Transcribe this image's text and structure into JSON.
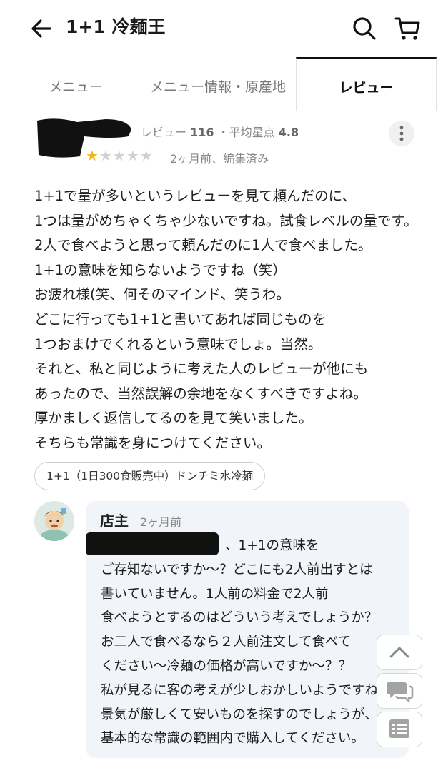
{
  "header": {
    "title": "1+1 冷麺王",
    "back_icon": "arrow-left-icon",
    "search_icon": "search-icon",
    "cart_icon": "cart-icon"
  },
  "tabs": [
    {
      "label": "メニュー",
      "active": false
    },
    {
      "label": "メニュー情報・原産地",
      "active": false
    },
    {
      "label": "レビュー",
      "active": true
    }
  ],
  "review": {
    "meta_prefix": "レビュー",
    "review_count": "116",
    "separator": "・",
    "avg_label": "平均星点",
    "avg_rating": "4.8",
    "rating": 1,
    "max_rating": 5,
    "date": "2ヶ月前、編集済み",
    "body": [
      "1+1で量が多いというレビューを見て頼んだのに、",
      "1つは量がめちゃくちゃ少ないですね。試食レベルの量です。",
      "2人で食べようと思って頼んだのに1人で食べました。",
      "1+1の意味を知らないようですね（笑）",
      "お疲れ様(笑、何そのマインド、笑うわ。",
      "どこに行っても1+1と書いてあれば同じものを",
      "1つおまけでくれるという意味でしょ。当然。",
      "それと、私と同じように考えた人のレビューが他にも",
      "あったので、当然誤解の余地をなくすべきですよね。",
      "厚かましく返信してるのを見て笑いました。",
      "そちらも常識を身につけてください。"
    ],
    "menu_tag": "1+1（1日300食販売中）ドンチミ水冷麺"
  },
  "reply": {
    "owner_name": "店主",
    "date": "2ヶ月前",
    "first_line_suffix": "、1+1の意味を",
    "body": [
      "ご存知ないですか～？どこにも2人前出すとは",
      "書いていません。1人前の料金で2人前",
      "食べようとするのはどういう考えでしょうか？",
      "お二人で食べるなら２人前注文して食べて",
      "ください～冷麺の価格が高いですか～？？",
      "私が見るに客の考えが少しおかしいようですね。",
      "景気が厳しくて安いものを探すのでしょうが、",
      "基本的な常識の範囲内で購入してください。"
    ]
  },
  "fabs": [
    "chevron-up-icon",
    "chat-icon",
    "list-icon"
  ],
  "colors": {
    "accent_star": "#f5b60a",
    "star_off": "#d0d0d0",
    "reply_bg": "#f1f4f9",
    "active_tab_border": "#111111"
  }
}
